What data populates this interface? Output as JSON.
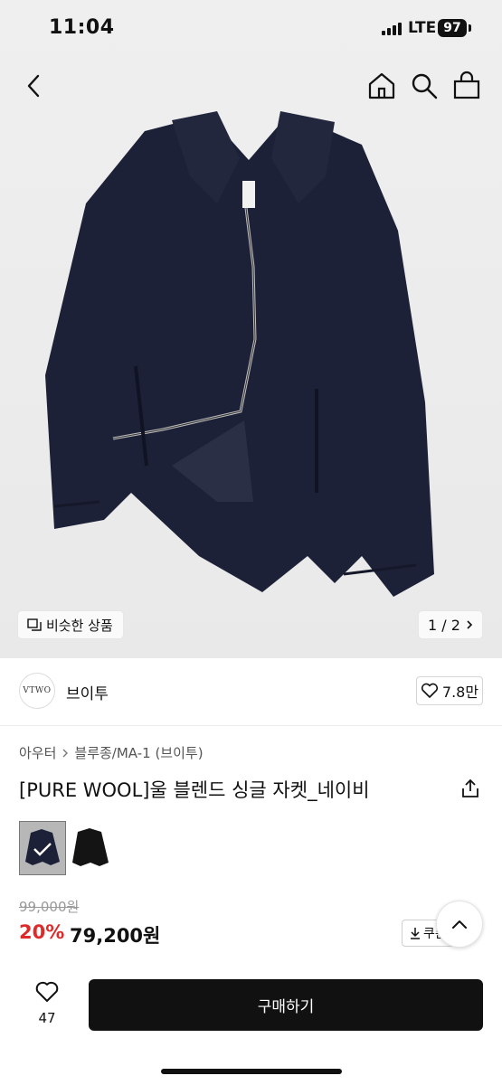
{
  "status_bar": {
    "time": "11:04",
    "network": "LTE",
    "battery": "97"
  },
  "hero": {
    "similar_label": "비슷한 상품",
    "pager": "1 / 2"
  },
  "brand": {
    "logo_text": "VTWO",
    "name": "브이투",
    "likes": "7.8만"
  },
  "breadcrumb": {
    "items": [
      "아우터",
      "블루종/MA-1 (브이투)"
    ]
  },
  "product": {
    "title": "[PURE WOOL]울 블렌드 싱글 자켓_네이비",
    "variants": [
      "navy",
      "black"
    ],
    "original_price": "99,000원",
    "discount": "20%",
    "price": "79,200원",
    "coupon_label": "쿠폰"
  },
  "bottom": {
    "wish_count": "47",
    "buy_label": "구매하기"
  },
  "colors": {
    "jacket": "#1c2036",
    "discount": "#e02a2a",
    "buy_button": "#111111"
  }
}
